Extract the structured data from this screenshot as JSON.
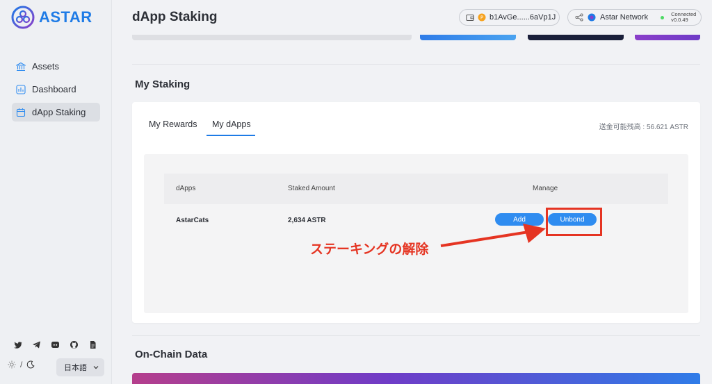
{
  "brand": {
    "name": "ASTAR"
  },
  "sidebar": {
    "items": [
      {
        "label": "Assets",
        "icon": "bank-icon",
        "active": false
      },
      {
        "label": "Dashboard",
        "icon": "chart-icon",
        "active": false
      },
      {
        "label": "dApp Staking",
        "icon": "calendar-icon",
        "active": true
      }
    ],
    "social_icons": [
      "twitter-icon",
      "telegram-icon",
      "discord-icon",
      "github-icon",
      "document-icon"
    ],
    "theme": {
      "separator": "/"
    },
    "language": {
      "value": "日本語"
    }
  },
  "header": {
    "title": "dApp Staking",
    "wallet": {
      "address": "b1AvGe......6aVp1J"
    },
    "network": {
      "name": "Astar Network",
      "status": "Connected",
      "version": "v0.0.49"
    }
  },
  "staking": {
    "section_title": "My Staking",
    "tabs": [
      {
        "label": "My Rewards",
        "active": false
      },
      {
        "label": "My dApps",
        "active": true
      }
    ],
    "balance_label": "送金可能残高 : 56.621 ASTR",
    "table": {
      "headers": {
        "dapps": "dApps",
        "staked": "Staked Amount",
        "manage": "Manage"
      },
      "rows": [
        {
          "dapp": "AstarCats",
          "staked": "2,634 ASTR",
          "add_label": "Add",
          "unbond_label": "Unbond"
        }
      ]
    },
    "annotation": "ステーキングの解除"
  },
  "onchain": {
    "section_title": "On-Chain Data"
  },
  "colors": {
    "accent": "#2f8cf0",
    "annotation": "#e53422",
    "brand": "#1e7be6"
  }
}
